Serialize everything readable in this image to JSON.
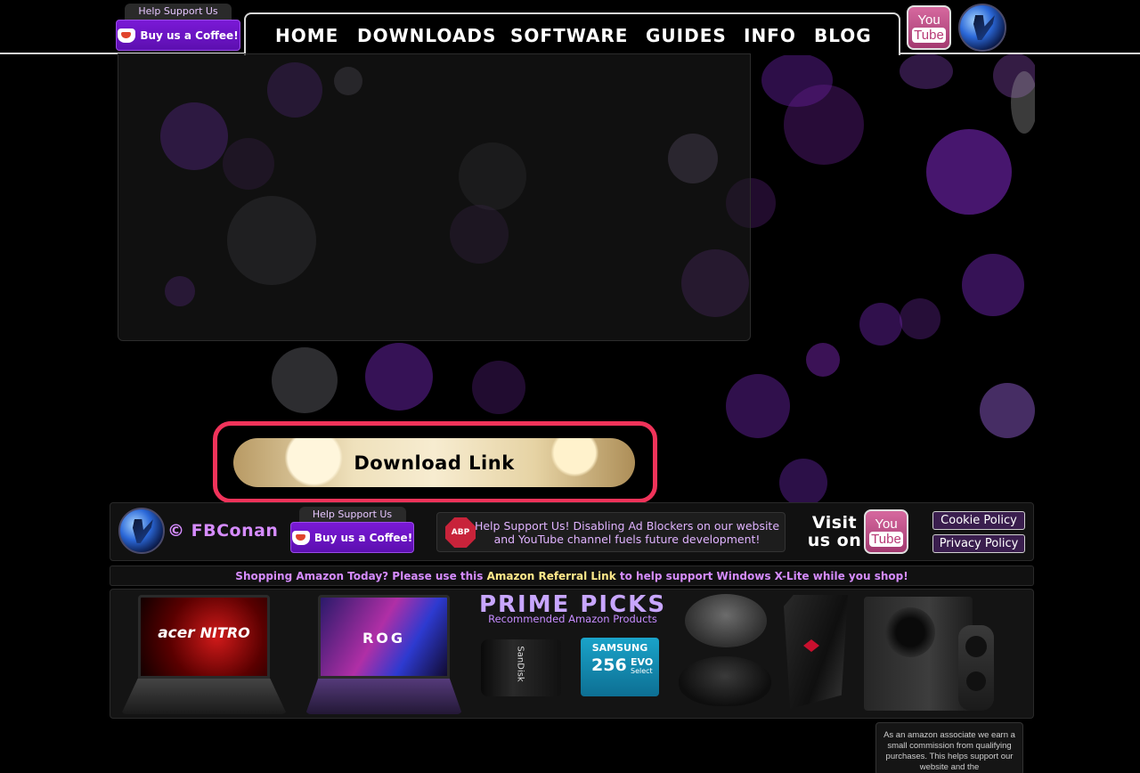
{
  "header": {
    "support_tag": "Help Support Us",
    "coffee_label": "Buy us a Coffee!",
    "nav": [
      "HOME",
      "DOWNLOADS",
      "SOFTWARE",
      "GUIDES",
      "INFO",
      "BLOG"
    ],
    "youtube_you": "You",
    "youtube_tube": "Tube"
  },
  "main": {
    "download_label": "Download Link"
  },
  "footer": {
    "brand": "© FBConan",
    "support_tag": "Help Support Us",
    "coffee_label": "Buy us a Coffee!",
    "abp_label": "ABP",
    "adblock_text": "Help Support Us! Disabling Ad Blockers on our website and YouTube channel fuels future development!",
    "visit_line1": "Visit",
    "visit_line2": "us on",
    "youtube_you": "You",
    "youtube_tube": "Tube",
    "cookie_policy": "Cookie Policy",
    "privacy_policy": "Privacy Policy"
  },
  "amazon": {
    "prefix": "Shopping Amazon Today? Please use this ",
    "link": "Amazon Referral Link",
    "suffix": " to help support Windows X-Lite while you shop!"
  },
  "products": {
    "acer_brand": "acer",
    "nitro_label": "NITRO",
    "rog_label": "ROG",
    "prime_title": "PRIME PICKS",
    "prime_sub": "Recommended Amazon Products",
    "sandisk_label": "SanDisk",
    "samsung_label": "SAMSUNG",
    "samsung_capacity": "256",
    "samsung_evo": "EVO",
    "samsung_select": "Select"
  },
  "note": {
    "text": "As an amazon associate we earn a small commission from qualifying purchases. This helps support our website and the"
  },
  "colors": {
    "accent_purple": "#7a19d6",
    "highlight_red": "#f0335a",
    "footer_text": "#d68cff",
    "link_yellow": "#ffe98a"
  }
}
